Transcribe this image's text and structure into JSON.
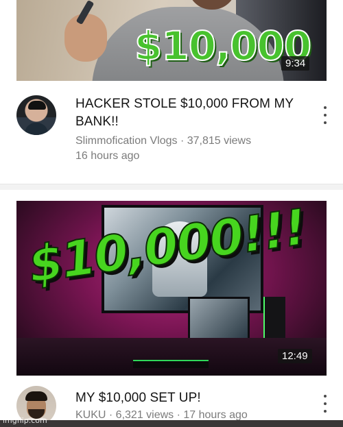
{
  "videos": [
    {
      "thumbnail_text": "$10,000",
      "duration": "9:34",
      "title": "HACKER STOLE $10,000 FROM MY BANK!!",
      "channel": "Slimmofication Vlogs",
      "views": "37,815 views",
      "age": "16 hours ago"
    },
    {
      "thumbnail_text": "$10,000!!!",
      "duration": "12:49",
      "title": "MY $10,000 SET UP!",
      "channel": "KUKU",
      "views": "6,321 views",
      "age": "17 hours ago"
    }
  ],
  "separator": " · ",
  "watermark": "imgflip.com",
  "icons": {
    "more": "vertical-ellipsis-icon"
  },
  "colors": {
    "money_green": "#48c22e",
    "meta_gray": "#7b7b7b"
  }
}
